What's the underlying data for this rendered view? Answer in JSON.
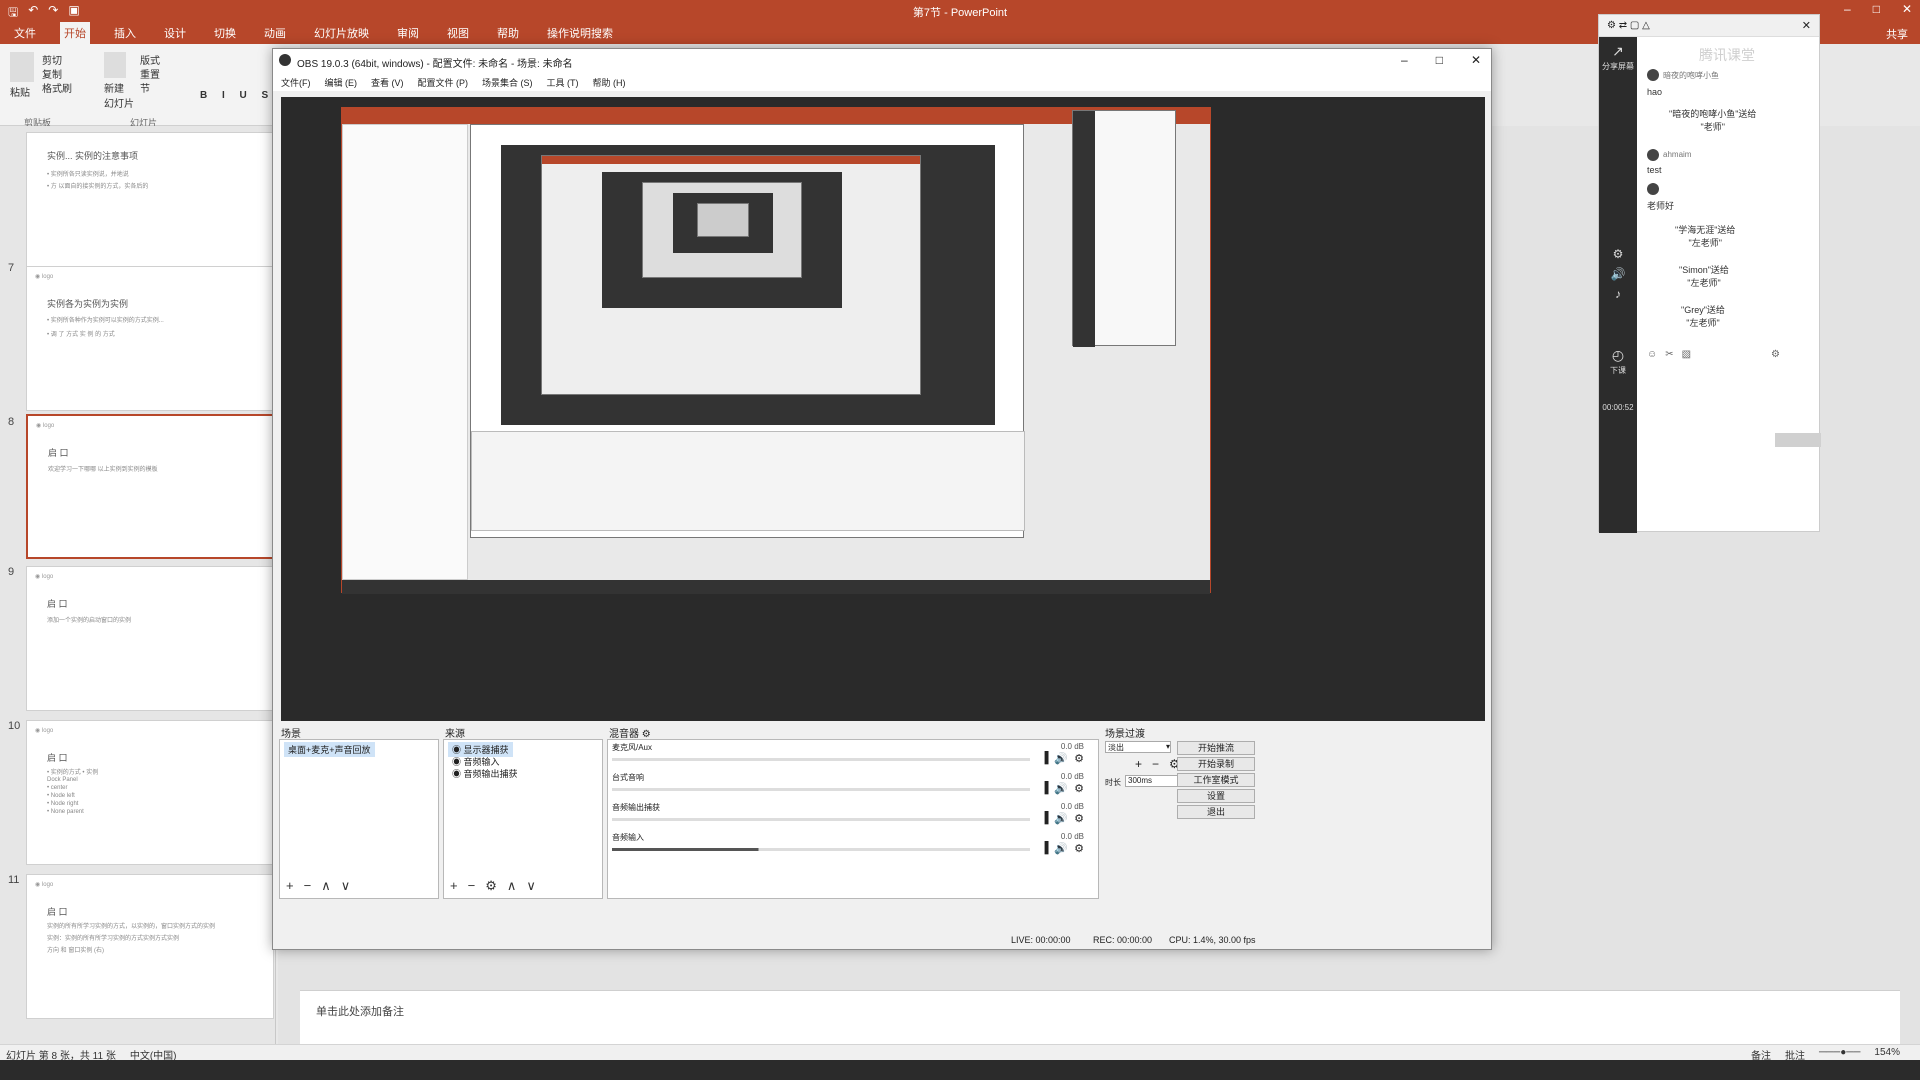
{
  "ppt": {
    "window_title": "第7节 - PowerPoint",
    "tabs": [
      "文件",
      "开始",
      "插入",
      "设计",
      "切换",
      "动画",
      "幻灯片放映",
      "审阅",
      "视图",
      "帮助",
      "操作说明搜索"
    ],
    "share": "共享",
    "ribbon": {
      "paste": "粘贴",
      "cut": "剪切",
      "copy": "复制",
      "format_painter": "格式刷",
      "new_slide": "新建\n幻灯片",
      "layout": "版式",
      "reset": "重置",
      "section": "节",
      "group_clipboard": "剪贴板",
      "group_slides": "幻灯片"
    },
    "thumbnails": [
      {
        "num": "",
        "title": "实例... 实例的注意事项",
        "lines": [
          "• 实例所各只读实例说，并地说",
          "• 方 以面自的接实例的方式，实各后的"
        ]
      },
      {
        "num": "7",
        "title": "实例各为实例为实例",
        "lines": [
          "• 实例所各种作为实例可以实例的方式实例...",
          "• 调 了 方式 实 例 的 方式"
        ]
      },
      {
        "num": "8",
        "title": "启 口",
        "lines": [
          "欢迎学习一下哪哪 以上实例到实例的模板"
        ]
      },
      {
        "num": "9",
        "title": "启 口",
        "lines": [
          "添加一个实例的启动窗口的实例"
        ]
      },
      {
        "num": "10",
        "title": "启 口",
        "lines": [
          "• 实例的方式 • 实例",
          "Dock Panel",
          "• center",
          "• Node left",
          "• Node right",
          "• None parent"
        ]
      },
      {
        "num": "11",
        "title": "启 口",
        "lines": [
          "实例的所有所学习实例的方式，以实例的，窗口实例方式的实例",
          "实例：实例的所有所学习实例的方式实例方式实例",
          "方向 和 窗口实例 (右)"
        ]
      }
    ],
    "notes_placeholder": "单击此处添加备注",
    "status": {
      "slide_info": "幻灯片 第 8 张，共 11 张",
      "lang": "中文(中国)",
      "notes": "备注",
      "comments": "批注",
      "zoom": "154%"
    }
  },
  "obs": {
    "title": "OBS 19.0.3 (64bit, windows) - 配置文件: 未命名 - 场景: 未命名",
    "menu": [
      "文件(F)",
      "编辑 (E)",
      "查看 (V)",
      "配置文件 (P)",
      "场景集合 (S)",
      "工具 (T)",
      "帮助 (H)"
    ],
    "docks": {
      "scenes_label": "场景",
      "sources_label": "来源",
      "mixer_label": "混音器",
      "transitions_label": "场景过渡"
    },
    "scenes": [
      "桌面+麦克+声音回放"
    ],
    "sources": [
      "显示器捕获",
      "音频输入",
      "音频输出捕获"
    ],
    "mixer": [
      {
        "name": "麦克风/Aux",
        "db": "0.0 dB"
      },
      {
        "name": "台式音响",
        "db": "0.0 dB"
      },
      {
        "name": "音频输出捕获",
        "db": "0.0 dB"
      },
      {
        "name": "音频输入",
        "db": "0.0 dB"
      }
    ],
    "transition": {
      "type": "淡出",
      "duration_label": "时长",
      "duration": "300ms"
    },
    "buttons": [
      "开始推流",
      "开始录制",
      "工作室模式",
      "设置",
      "退出"
    ],
    "status": {
      "live": "LIVE: 00:00:00",
      "rec": "REC: 00:00:00",
      "cpu": "CPU: 1.4%, 30.00 fps"
    }
  },
  "live_panel": {
    "share_screen": "分享屏幕",
    "logo_text": "腾讯课堂",
    "chat": [
      {
        "name": "暗夜的咆哮小鱼",
        "msg": "hao"
      },
      {
        "name": "",
        "msg": "\"暗夜的咆哮小鱼\"送给\n\"老师\""
      },
      {
        "name": "ahmaim",
        "msg": "test"
      },
      {
        "name": "",
        "msg": "老师好"
      },
      {
        "name": "",
        "msg": "\"学海无涯\"送给\n\"左老师\""
      },
      {
        "name": "",
        "msg": "\"Simon\"送给\n\"左老师\""
      },
      {
        "name": "",
        "msg": "\"Grey\"送给\n\"左老师\""
      }
    ],
    "timer": "00:00:52",
    "down_class": "下课"
  },
  "colors": {
    "ppt_red": "#b7472a",
    "obs_bg": "#f0f0f0",
    "preview_bg": "#2a2a2a"
  }
}
